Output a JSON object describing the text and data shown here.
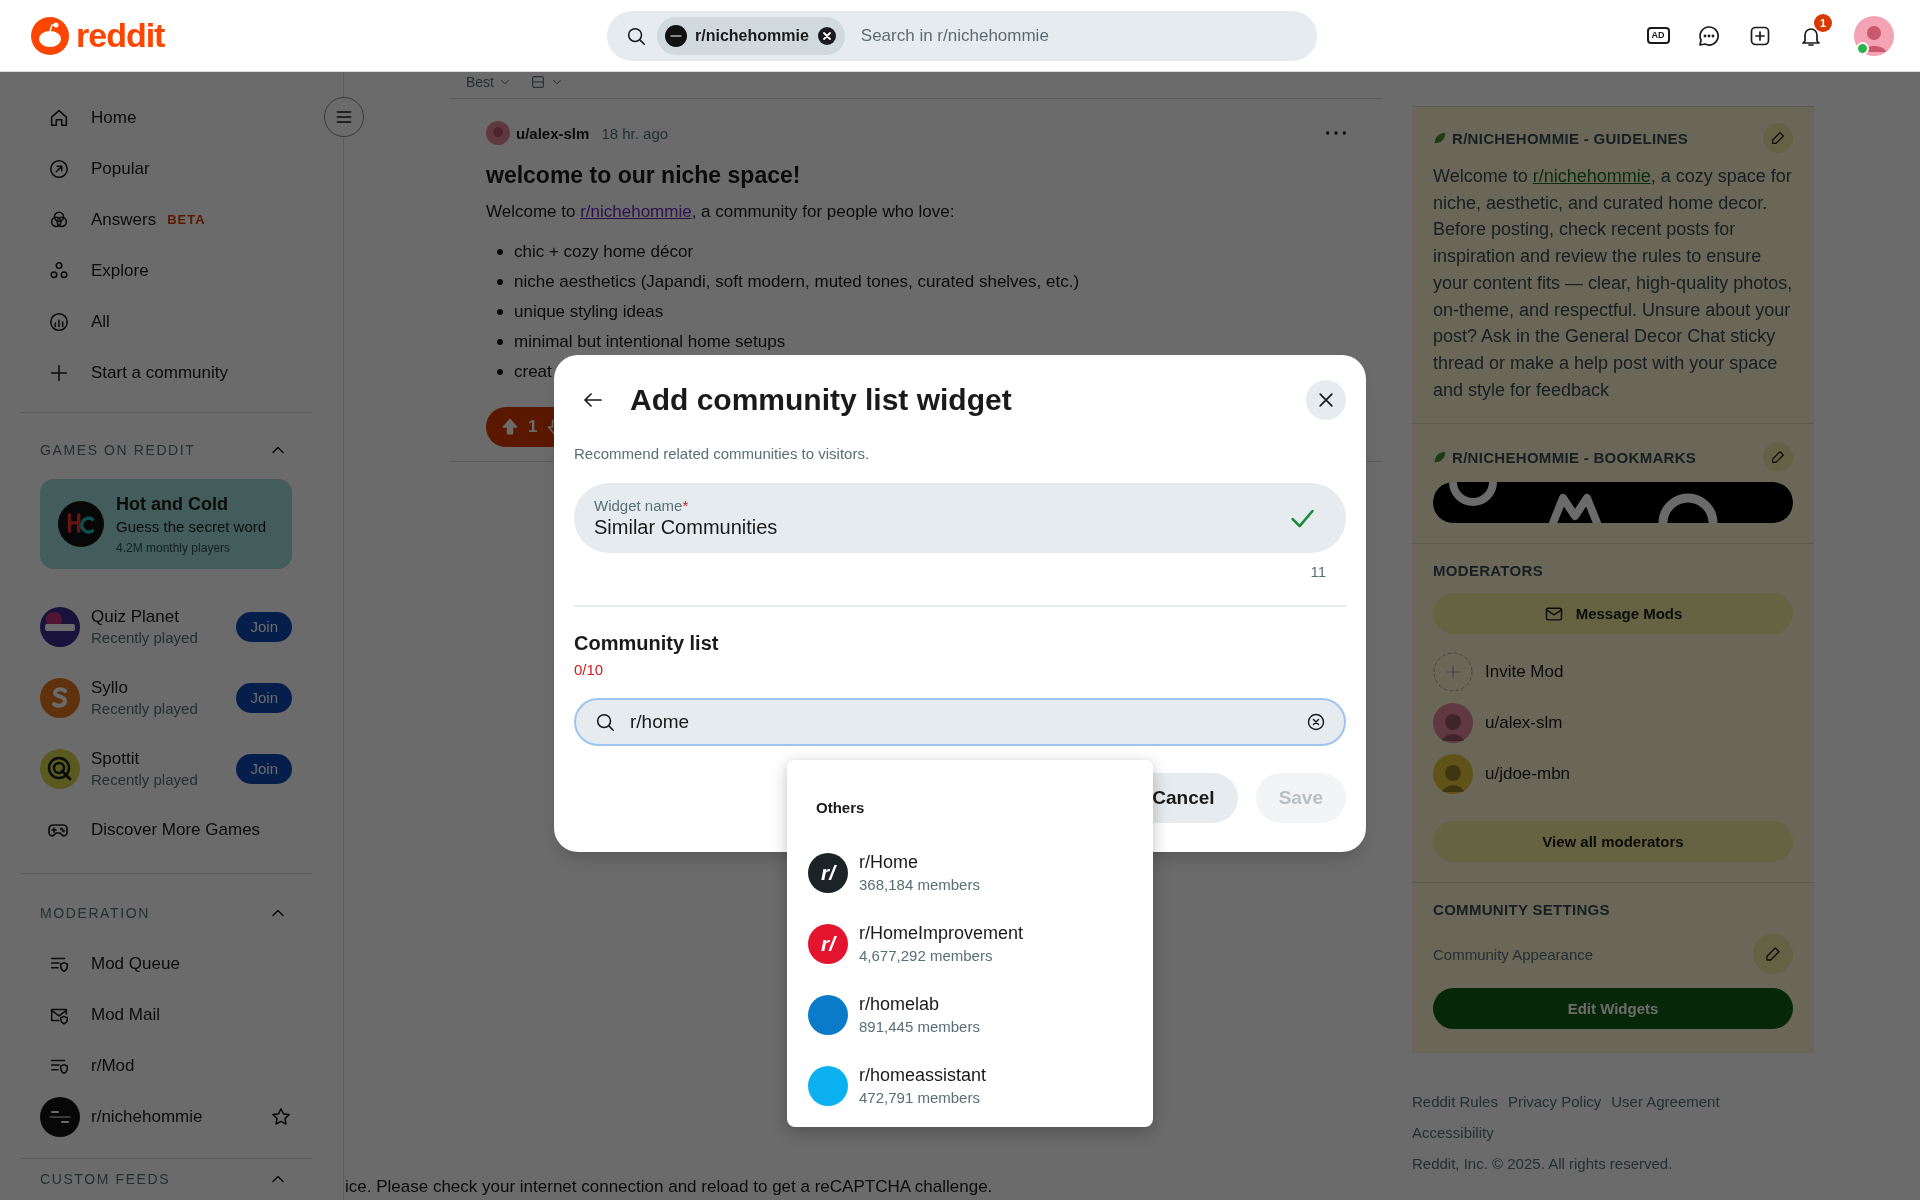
{
  "header": {
    "logo_text": "reddit",
    "search": {
      "community": "r/nichehommie",
      "placeholder": "Search in r/nichehommie"
    },
    "advertise_label": "AD",
    "notification_count": "1"
  },
  "sidebar": {
    "nav": [
      {
        "label": "Home"
      },
      {
        "label": "Popular"
      },
      {
        "label": "Answers",
        "badge": "BETA"
      },
      {
        "label": "Explore"
      },
      {
        "label": "All"
      },
      {
        "label": "Start a community"
      }
    ],
    "games": {
      "title": "GAMES ON REDDIT",
      "expanded": true,
      "featured": {
        "title": "Hot and Cold",
        "subtitle": "Guess the secret word",
        "players": "4.2M monthly players"
      },
      "items": [
        {
          "name": "Quiz Planet",
          "status": "Recently played",
          "action": "Join"
        },
        {
          "name": "Syllo",
          "status": "Recently played",
          "action": "Join"
        },
        {
          "name": "Spottit",
          "status": "Recently played",
          "action": "Join"
        }
      ],
      "discover": "Discover More Games"
    },
    "moderation": {
      "title": "MODERATION",
      "expanded": true,
      "items": [
        {
          "label": "Mod Queue"
        },
        {
          "label": "Mod Mail"
        },
        {
          "label": "r/Mod"
        }
      ],
      "community": {
        "name": "r/nichehommie",
        "starred": false
      }
    },
    "custom_feeds": {
      "title": "CUSTOM FEEDS",
      "expanded": true
    }
  },
  "feed": {
    "sort": "Best",
    "post": {
      "author": "u/alex-slm",
      "time": "18 hr. ago",
      "title": "welcome to our niche space!",
      "text_before": "Welcome to ",
      "link": "r/nichehommie",
      "text_after": ", a community for people who love:",
      "bullets": [
        "chic + cozy home décor",
        "niche aesthetics (Japandi, soft modern, muted tones, curated shelves, etc.)",
        "unique styling ideas",
        "minimal but intentional home setups",
        "creat"
      ],
      "votes": "1"
    },
    "notice": "ice. Please check your internet connection and reload to get a reCAPTCHA challenge."
  },
  "right": {
    "guidelines": {
      "title": "R/NICHEHOMMIE - GUIDELINES",
      "text_before": "Welcome to ",
      "link": "r/nichehommie",
      "text_after": ", a cozy space for niche, aesthetic, and curated home decor. Before posting, check recent posts for inspiration and review the rules to ensure your content fits — clear, high-quality photos, on-theme, and respectful. Unsure about your post? Ask in the General Decor Chat sticky thread or make a help post with your space and style for feedback"
    },
    "bookmarks": {
      "title": "R/NICHEHOMMIE - BOOKMARKS"
    },
    "moderators": {
      "title": "MODERATORS",
      "message_button": "Message Mods",
      "invite": "Invite Mod",
      "mods": [
        {
          "name": "u/alex-slm"
        },
        {
          "name": "u/jdoe-mbn"
        }
      ],
      "view_all": "View all moderators"
    },
    "settings": {
      "title": "COMMUNITY SETTINGS",
      "appearance": "Community Appearance",
      "edit_button": "Edit Widgets"
    },
    "footer": {
      "links": [
        "Reddit Rules",
        "Privacy Policy",
        "User Agreement",
        "Accessibility"
      ],
      "copyright": "Reddit, Inc. © 2025. All rights reserved."
    }
  },
  "modal": {
    "title": "Add community list widget",
    "subtitle": "Recommend related communities to visitors.",
    "widget_name": {
      "label": "Widget name",
      "required_mark": "*",
      "value": "Similar Communities",
      "valid": true,
      "count": "11"
    },
    "list": {
      "title": "Community list",
      "count": "0/10",
      "search_value": "r/home",
      "focused": true
    },
    "cancel": "Cancel",
    "save": {
      "label": "Save",
      "disabled": true
    }
  },
  "dropdown": {
    "heading": "Others",
    "results": [
      {
        "name": "r/Home",
        "members": "368,184 members",
        "color": "#1c2326",
        "icon_text": "r/"
      },
      {
        "name": "r/HomeImprovement",
        "members": "4,677,292 members",
        "color": "#e4142f",
        "icon_text": "r/"
      },
      {
        "name": "r/homelab",
        "members": "891,445 members",
        "color": "#0a7bc8"
      },
      {
        "name": "r/homeassistant",
        "members": "472,791 members",
        "color": "#0ab0f0"
      }
    ]
  }
}
